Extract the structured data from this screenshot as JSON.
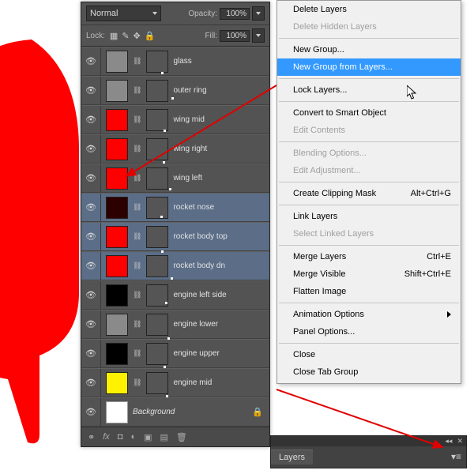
{
  "panel": {
    "blend_mode": "Normal",
    "opacity_label": "Opacity:",
    "opacity_value": "100%",
    "lock_label": "Lock:",
    "fill_label": "Fill:",
    "fill_value": "100%"
  },
  "layers": [
    {
      "name": "glass",
      "color": "gray",
      "selected": false,
      "italic": false,
      "locked": false
    },
    {
      "name": "outer ring",
      "color": "gray",
      "selected": false,
      "italic": false,
      "locked": false
    },
    {
      "name": "wing mid",
      "color": "red",
      "selected": false,
      "italic": false,
      "locked": false
    },
    {
      "name": "wing right",
      "color": "red",
      "selected": false,
      "italic": false,
      "locked": false
    },
    {
      "name": "wing left",
      "color": "red",
      "selected": false,
      "italic": false,
      "locked": false
    },
    {
      "name": "rocket nose",
      "color": "darkred",
      "selected": true,
      "italic": false,
      "locked": false
    },
    {
      "name": "rocket body top",
      "color": "red",
      "selected": true,
      "italic": false,
      "locked": false
    },
    {
      "name": "rocket body dn",
      "color": "red",
      "selected": true,
      "italic": false,
      "locked": false
    },
    {
      "name": "engine left side",
      "color": "black",
      "selected": false,
      "italic": false,
      "locked": false
    },
    {
      "name": "engine lower",
      "color": "gray",
      "selected": false,
      "italic": false,
      "locked": false
    },
    {
      "name": "engine upper",
      "color": "black",
      "selected": false,
      "italic": false,
      "locked": false
    },
    {
      "name": "engine mid",
      "color": "yellow",
      "selected": false,
      "italic": false,
      "locked": false
    },
    {
      "name": "Background",
      "color": "white",
      "selected": false,
      "italic": true,
      "locked": true
    }
  ],
  "menu": [
    {
      "label": "Delete Layers",
      "type": "item"
    },
    {
      "label": "Delete Hidden Layers",
      "type": "item",
      "disabled": true
    },
    {
      "type": "sep"
    },
    {
      "label": "New Group...",
      "type": "item"
    },
    {
      "label": "New Group from Layers...",
      "type": "item",
      "highlight": true
    },
    {
      "type": "sep"
    },
    {
      "label": "Lock Layers...",
      "type": "item"
    },
    {
      "type": "sep"
    },
    {
      "label": "Convert to Smart Object",
      "type": "item"
    },
    {
      "label": "Edit Contents",
      "type": "item",
      "disabled": true
    },
    {
      "type": "sep"
    },
    {
      "label": "Blending Options...",
      "type": "item",
      "disabled": true
    },
    {
      "label": "Edit Adjustment...",
      "type": "item",
      "disabled": true
    },
    {
      "type": "sep"
    },
    {
      "label": "Create Clipping Mask",
      "type": "item",
      "shortcut": "Alt+Ctrl+G"
    },
    {
      "type": "sep"
    },
    {
      "label": "Link Layers",
      "type": "item"
    },
    {
      "label": "Select Linked Layers",
      "type": "item",
      "disabled": true
    },
    {
      "type": "sep"
    },
    {
      "label": "Merge Layers",
      "type": "item",
      "shortcut": "Ctrl+E"
    },
    {
      "label": "Merge Visible",
      "type": "item",
      "shortcut": "Shift+Ctrl+E"
    },
    {
      "label": "Flatten Image",
      "type": "item"
    },
    {
      "type": "sep"
    },
    {
      "label": "Animation Options",
      "type": "sub"
    },
    {
      "label": "Panel Options...",
      "type": "item"
    },
    {
      "type": "sep"
    },
    {
      "label": "Close",
      "type": "item"
    },
    {
      "label": "Close Tab Group",
      "type": "item"
    }
  ],
  "minitab": {
    "label": "Layers"
  }
}
